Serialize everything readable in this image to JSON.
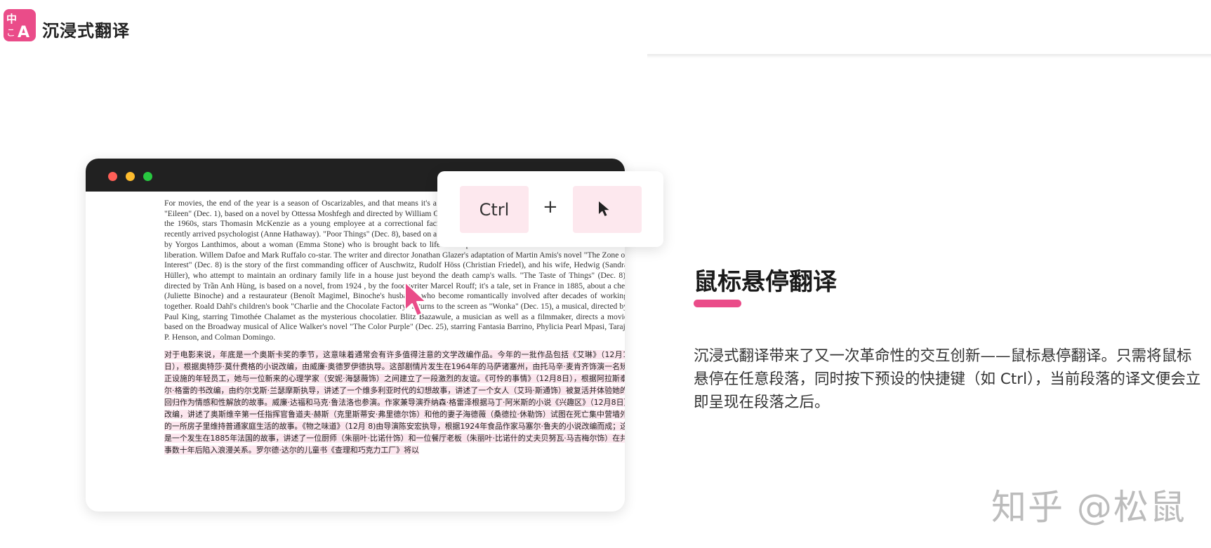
{
  "header": {
    "app_name": "沉浸式翻译"
  },
  "browser_mockup": {
    "english_paragraph": "For movies, the end of the year is a season of Oscarizables, and that means it's a season of literary adaptations. This year's batch includes \"Eileen\" (Dec. 1), based on a novel by Ottessa Moshfegh and directed by William Oldroyd. The drama, which takes place in Massachusetts in the 1960s, stars Thomasin McKenzie as a young employee at a correctional facility who is drawn into an unsettling relationship with a recently arrived psychologist (Anne Hathaway). \"Poor Things\" (Dec. 8), based on a book by Alasdair Gray, is a Victorian-era fantasy, directed by Yorgos Lanthimos, about a woman (Emma Stone) who is brought back to life and experiences her return as an emotional and sexual liberation. Willem Dafoe and Mark Ruffalo co-star. The writer and director Jonathan Glazer's adaptation of Martin Amis's novel \"The Zone of Interest\" (Dec. 8) is the story of the first commanding officer of Auschwitz, Rudolf Höss (Christian Friedel), and his wife, Hedwig (Sandra Hüller), who attempt to maintain an ordinary family life in a house just beyond the death camp's walls. \"The Taste of Things\" (Dec. 8), directed by Trần Anh Hùng, is based on a novel, from 1924 , by the food writer Marcel Rouff; it's a tale, set in France in 1885, about a chef (Juliette Binoche) and a restaurateur (Benoît Magimel, Binoche's husband) who become romantically involved after decades of working together. Roald Dahl's children's book \"Charlie and the Chocolate Factory\" returns to the screen as \"Wonka\" (Dec. 15), a musical, directed by Paul King, starring Timothée Chalamet as the mysterious chocolatier. Blitz Bazawule, a musician as well as a filmmaker, directs a movie based on the Broadway musical of Alice Walker's novel \"The Color Purple\" (Dec. 25), starring Fantasia Barrino, Phylicia Pearl Mpasi, Taraji P. Henson, and Colman Domingo.",
    "chinese_translation": "对于电影来说，年底是一个奥斯卡奖的季节，这意味着通常会有许多值得注意的文学改编作品。今年的一批作品包括《艾琳》（12月1日），根据奥特莎·莫什费格的小说改编，由威廉·奥德罗伊德执导。这部剧情片发生在1964年的马萨诸塞州，由托马辛·麦肯齐饰演一名矫正设施的年轻员工，她与一位新来的心理学家（安妮·海瑟薇饰）之间建立了一段激烈的友谊。《可怜的事情》（12月8日），根据阿拉斯泰尔·格雷的书改编，由约尔戈斯·兰瑟摩斯执导，讲述了一个维多利亚时代的幻想故事，讲述了一个女人（艾玛·斯通饰）被复活并体验她的回归作为情感和性解放的故事。威廉·达福和马克·鲁法洛也参演。作家兼导演乔纳森·格雷泽根据马丁·阿米斯的小说《兴趣区》（12月8日）改编，讲述了奥斯维辛第一任指挥官鲁道夫·赫斯（克里斯蒂安·弗里德尔饰）和他的妻子海德薇（桑德拉·休勒饰）试图在死亡集中营墙外的一所房子里维持普通家庭生活的故事。《物之味道》（12月 8)由导演陈安宏执导，根据1924年食品作家马塞尔·鲁夫的小说改编而成；这是一个发生在1885年法国的故事，讲述了一位厨师（朱丽叶·比诺什饰）和一位餐厅老板（朱丽叶·比诺什的丈夫贝努瓦·马吉梅尔饰）在共事数十年后陷入浪漫关系。罗尔德·达尔的儿童书《查理和巧克力工厂》将以"
  },
  "shortcut": {
    "key_label": "Ctrl",
    "plus": "+",
    "click_icon": "mouse-pointer-icon"
  },
  "feature": {
    "title": "鼠标悬停翻译",
    "description": "沉浸式翻译带来了又一次革命性的交互创新——鼠标悬停翻译。只需将鼠标悬停在任意段落，同时按下预设的快捷键（如 Ctrl），当前段落的译文便会立即呈现在段落之后。"
  },
  "watermark": "知乎 @松鼠",
  "colors": {
    "brand": "#ea4c89",
    "key_background": "#fde8ee",
    "translation_highlight": "#fce6ee",
    "titlebar": "#212121"
  }
}
